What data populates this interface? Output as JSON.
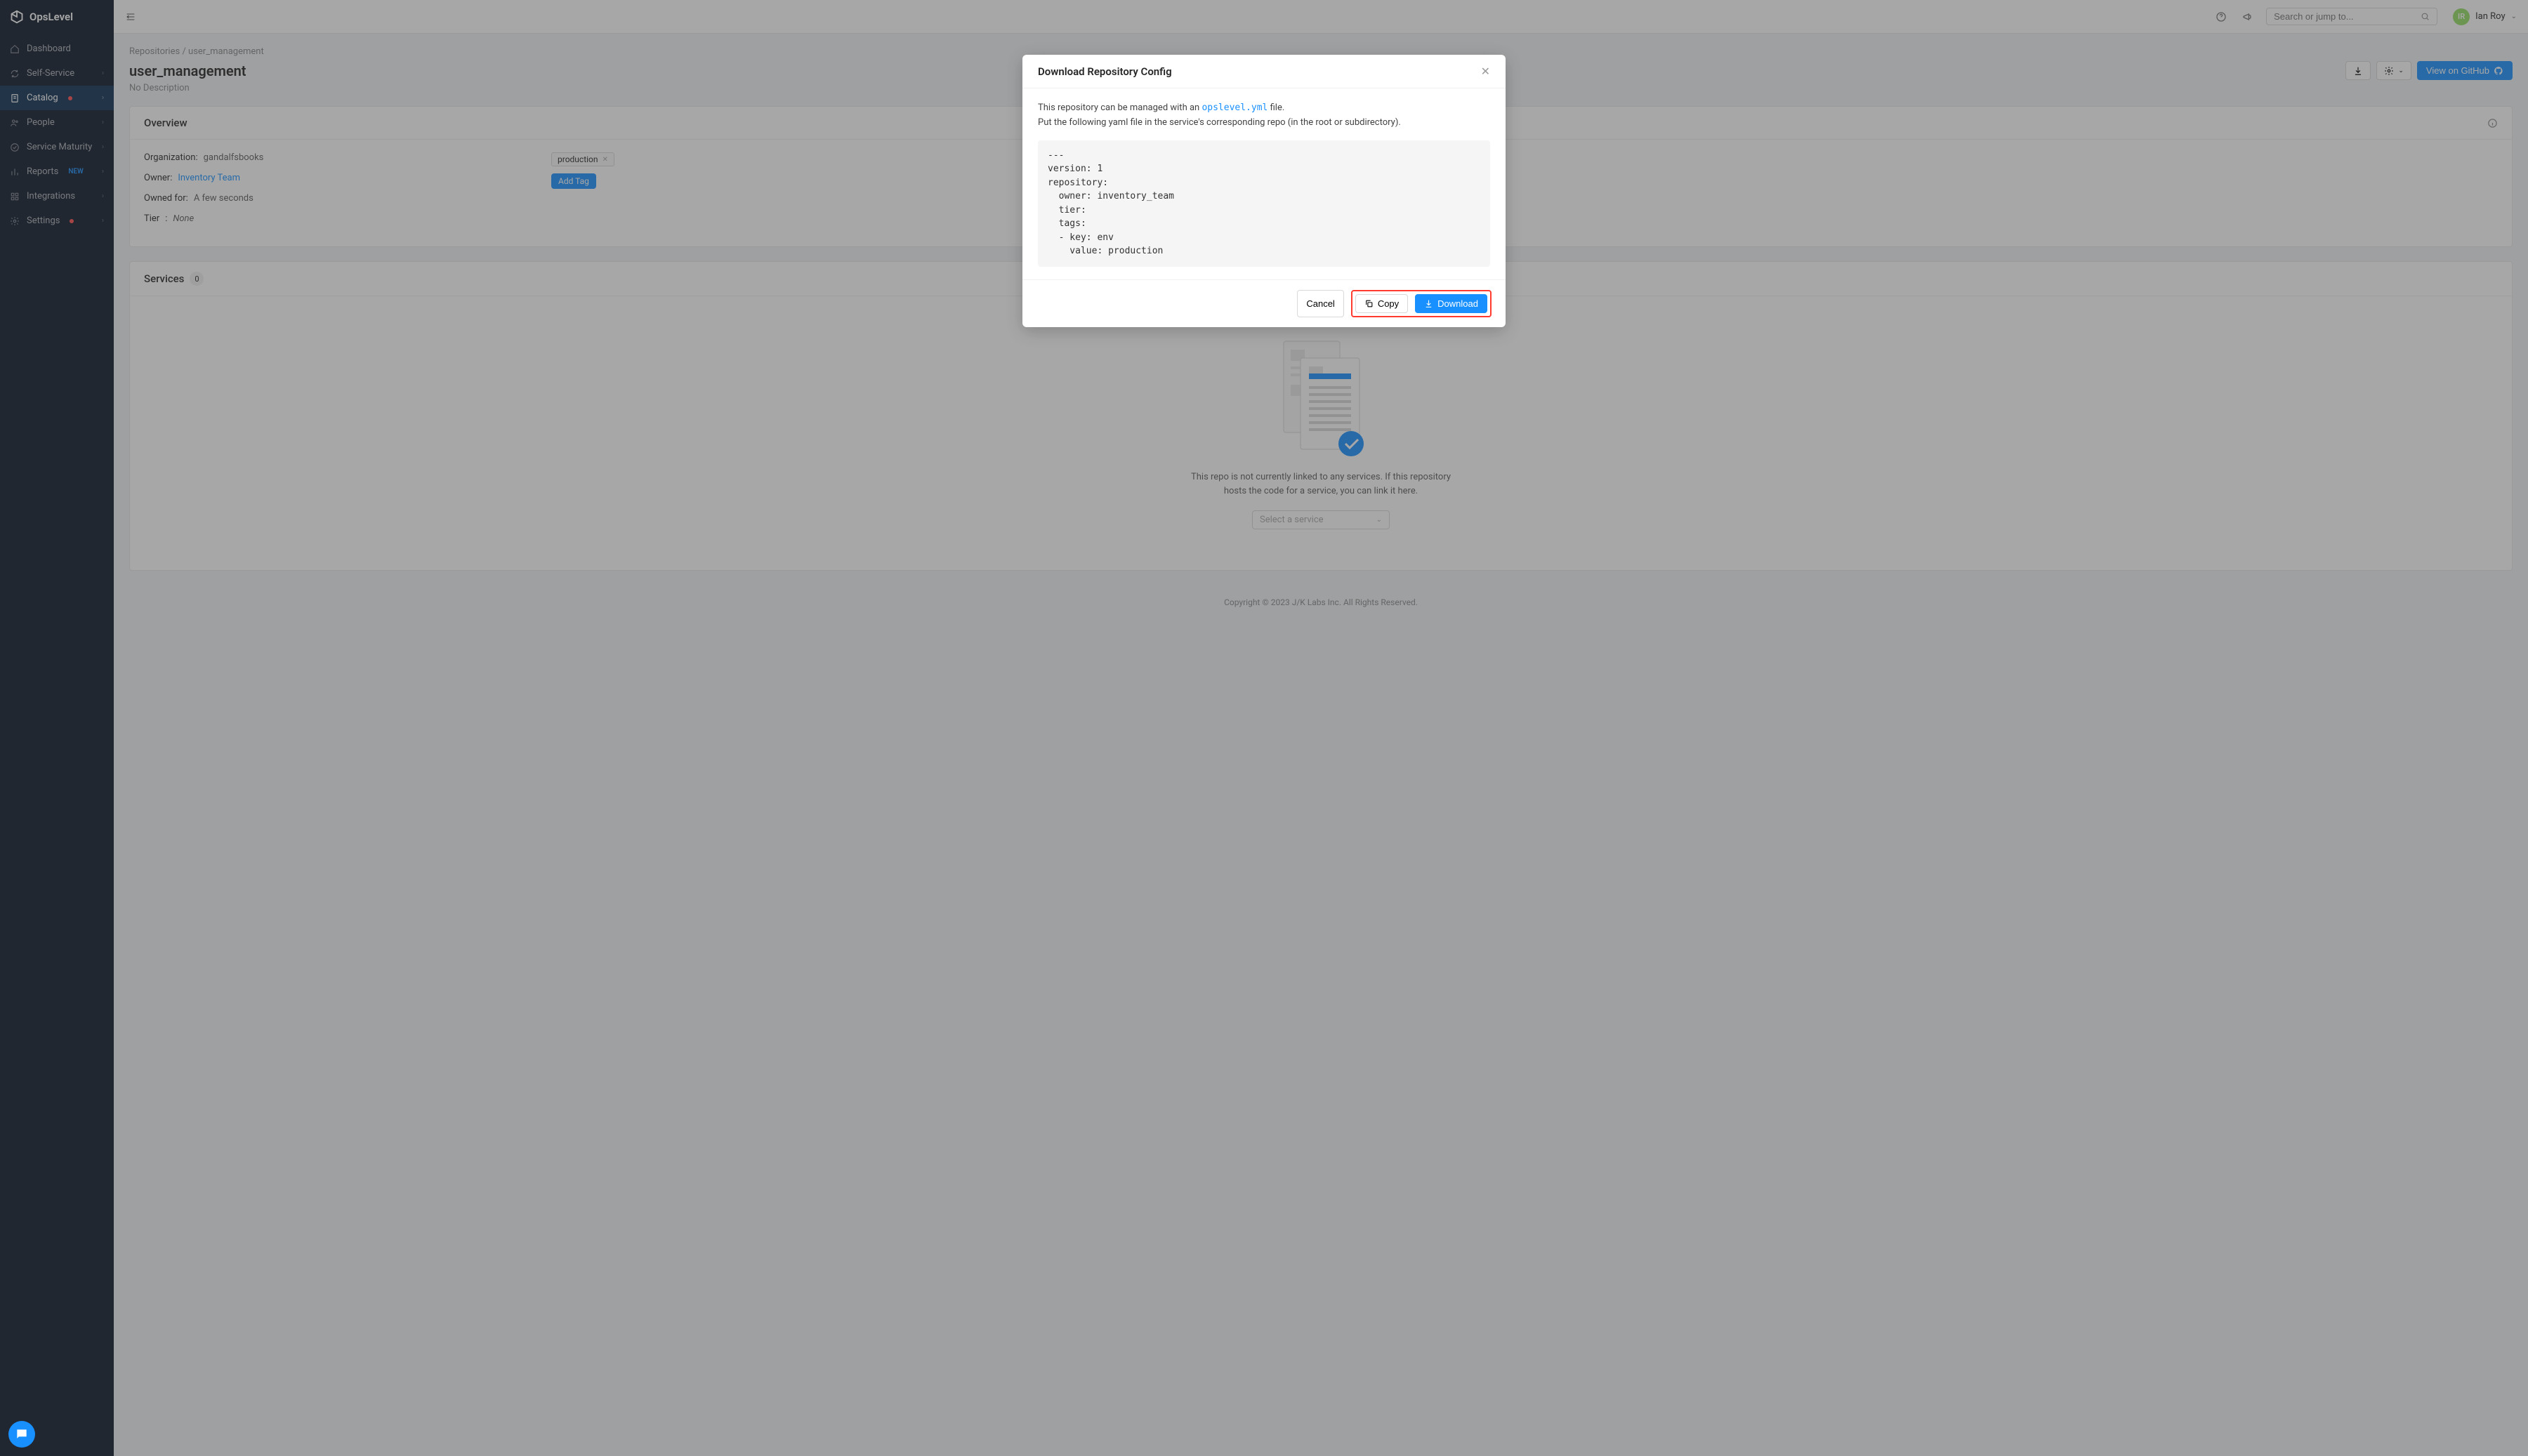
{
  "brand": {
    "name": "OpsLevel"
  },
  "sidebar": {
    "items": [
      {
        "label": "Dashboard",
        "icon": "home"
      },
      {
        "label": "Self-Service",
        "icon": "refresh",
        "expandable": true
      },
      {
        "label": "Catalog",
        "icon": "file",
        "expandable": true,
        "dot": true,
        "active": true
      },
      {
        "label": "People",
        "icon": "users",
        "expandable": true
      },
      {
        "label": "Service Maturity",
        "icon": "check-circle",
        "expandable": true
      },
      {
        "label": "Reports",
        "icon": "bar-chart",
        "badge": "NEW",
        "expandable": true
      },
      {
        "label": "Integrations",
        "icon": "grid",
        "expandable": true
      },
      {
        "label": "Settings",
        "icon": "gear",
        "dot": true,
        "expandable": true
      }
    ]
  },
  "topbar": {
    "search_placeholder": "Search or jump to...",
    "user_initials": "IR",
    "user_name": "Ian Roy"
  },
  "breadcrumb": {
    "root": "Repositories",
    "current": "user_management"
  },
  "page_title": "user_management",
  "no_description": "No Description",
  "actions": {
    "view_on_github": "View on GitHub"
  },
  "overview": {
    "title": "Overview",
    "organization_label": "Organization:",
    "organization_value": "gandalfsbooks",
    "owner_label": "Owner:",
    "owner_value": "Inventory Team",
    "owned_for_label": "Owned for:",
    "owned_for_value": "A few seconds",
    "tier_label": "Tier",
    "tier_value": "None",
    "tag_text": "production",
    "add_tag": "Add Tag"
  },
  "services": {
    "title": "Services",
    "count": "0",
    "empty_text": "This repo is not currently linked to any services. If this repository hosts the code for a service, you can link it here.",
    "select_placeholder": "Select a service"
  },
  "footer": "Copyright © 2023 J/K Labs Inc. All Rights Reserved.",
  "modal": {
    "title": "Download Repository Config",
    "intro_pre": "This repository can be managed with an ",
    "intro_code": "opslevel.yml",
    "intro_post": " file.",
    "intro_line2": "Put the following yaml file in the service's corresponding repo (in the root or subdirectory).",
    "yaml": "---\nversion: 1\nrepository:\n  owner: inventory_team\n  tier:\n  tags:\n  - key: env\n    value: production",
    "cancel": "Cancel",
    "copy": "Copy",
    "download": "Download"
  }
}
